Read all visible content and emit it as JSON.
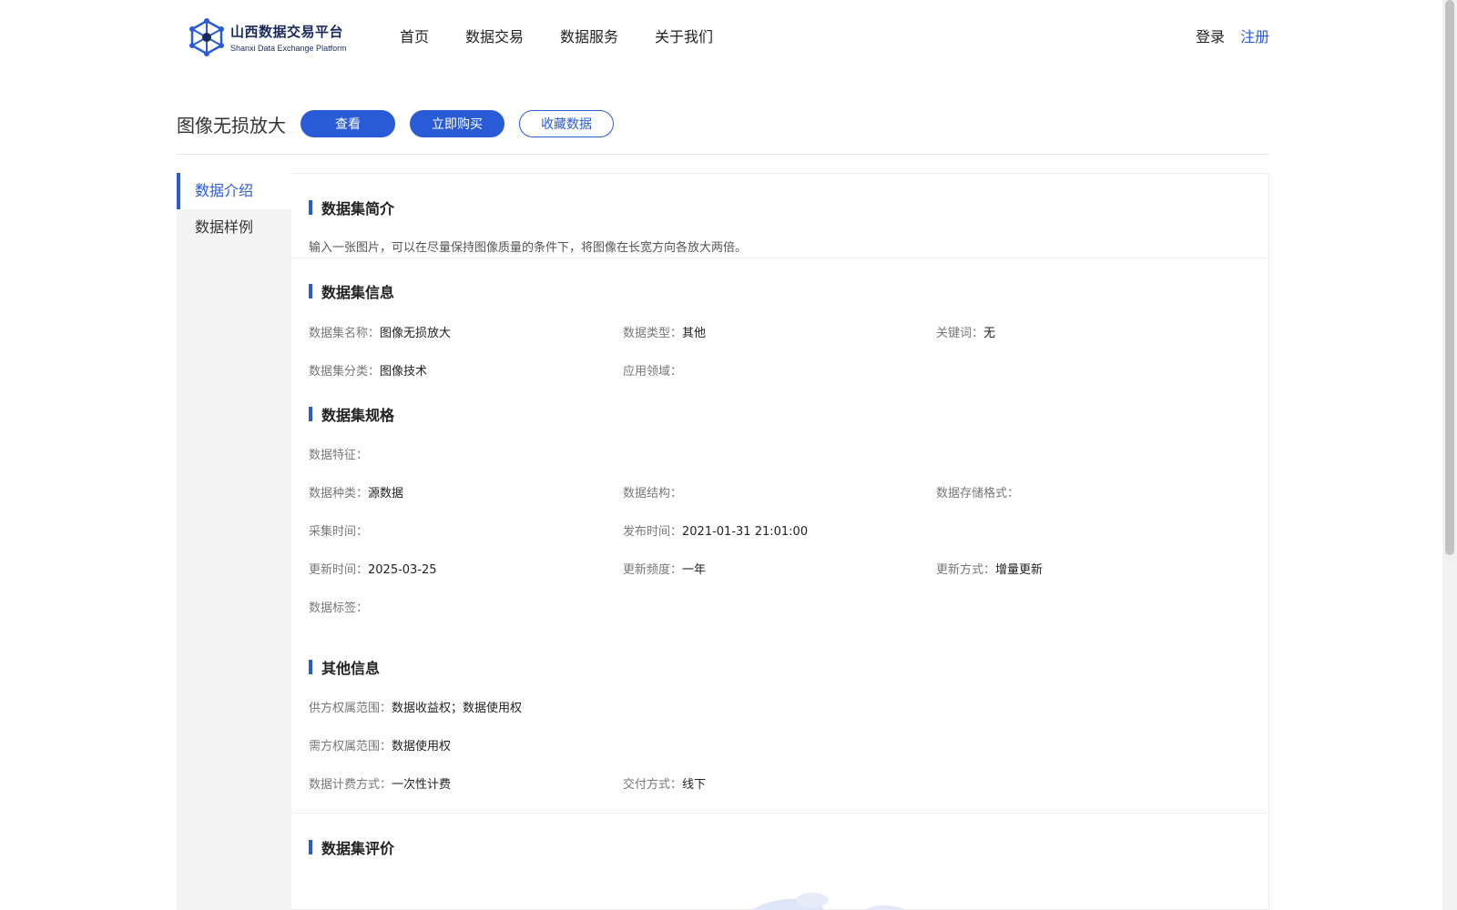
{
  "header": {
    "logo": {
      "title_cn": "山西数据交易平台",
      "title_en": "Shanxi Data Exchange Platform"
    },
    "nav": [
      "首页",
      "数据交易",
      "数据服务",
      "关于我们"
    ],
    "login_label": "登录",
    "register_label": "注册"
  },
  "title_bar": {
    "title": "图像无损放大",
    "view_label": "查看",
    "buy_label": "立即购买",
    "favorite_label": "收藏数据"
  },
  "sidebar": {
    "items": [
      {
        "label": "数据介绍",
        "active": true
      },
      {
        "label": "数据样例",
        "active": false
      }
    ]
  },
  "sections": {
    "intro": {
      "title": "数据集简介",
      "text": "输入一张图片，可以在尽量保持图像质量的条件下，将图像在长宽方向各放大两倍。"
    },
    "info": {
      "title": "数据集信息",
      "fields": {
        "name": {
          "label": "数据集名称：",
          "value": "图像无损放大"
        },
        "type": {
          "label": "数据类型：",
          "value": "其他"
        },
        "keywords": {
          "label": "关键词：",
          "value": "无"
        },
        "category": {
          "label": "数据集分类：",
          "value": "图像技术"
        },
        "domain": {
          "label": "应用领域：",
          "value": ""
        }
      }
    },
    "spec": {
      "title": "数据集规格",
      "fields": {
        "features": {
          "label": "数据特征：",
          "value": ""
        },
        "kind": {
          "label": "数据种类：",
          "value": "源数据"
        },
        "structure": {
          "label": "数据结构：",
          "value": ""
        },
        "storage": {
          "label": "数据存储格式：",
          "value": ""
        },
        "collect_time": {
          "label": "采集时间：",
          "value": ""
        },
        "publish_time": {
          "label": "发布时间：",
          "value": "2021-01-31 21:01:00"
        },
        "update_time": {
          "label": "更新时间：",
          "value": "2025-03-25"
        },
        "update_freq": {
          "label": "更新频度：",
          "value": "一年"
        },
        "update_mode": {
          "label": "更新方式：",
          "value": "增量更新"
        },
        "tags": {
          "label": "数据标签：",
          "value": ""
        }
      }
    },
    "other": {
      "title": "其他信息",
      "fields": {
        "supply_rights": {
          "label": "供方权属范围：",
          "value": "数据收益权；数据使用权"
        },
        "demand_rights": {
          "label": "需方权属范围：",
          "value": "数据使用权"
        },
        "billing": {
          "label": "数据计费方式：",
          "value": "一次性计费"
        },
        "delivery": {
          "label": "交付方式：",
          "value": "线下"
        }
      }
    },
    "review": {
      "title": "数据集评价"
    }
  },
  "colors": {
    "accent": "#2a5bd7",
    "sidebar_bg": "#f4f4f4"
  },
  "icons": [
    "network-logo-icon"
  ]
}
